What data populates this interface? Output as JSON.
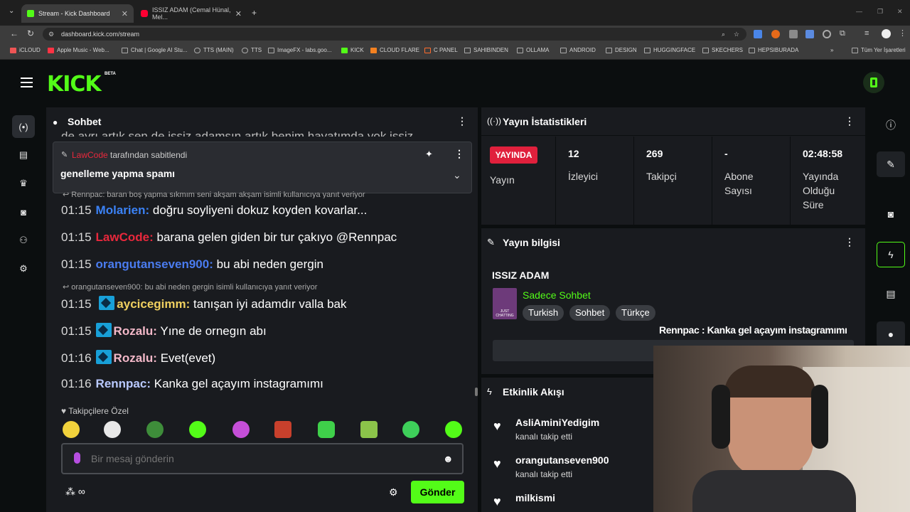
{
  "browser": {
    "tabs": [
      {
        "title": "Stream - Kick Dashboard",
        "active": true
      },
      {
        "title": "ISSIZ ADAM (Cemal Hünal, Mel...",
        "active": false
      }
    ],
    "url": "dashboard.kick.com/stream",
    "bookmarks": [
      "iCLOUD",
      "Apple Music - Web...",
      "Chat | Google AI Stu...",
      "TTS (MAIN)",
      "TTS",
      "ImageFX - labs.goo...",
      "KICK",
      "CLOUD FLARE",
      "C PANEL",
      "SAHIBINDEN",
      "OLLAMA",
      "ANDROID",
      "DESIGN",
      "HUGGINGFACE",
      "SKECHERS",
      "HEPSIBURADA"
    ],
    "all_bookmarks": "Tüm Yer İşaretleri"
  },
  "brand": {
    "logo": "KICK",
    "beta": "BETA",
    "accent": "#53fc18"
  },
  "chat": {
    "title": "Sohbet",
    "cut_line": "de ayrı artık sen de issiz adamsın artık benim hayatımda yok issiz",
    "pinned": {
      "user": "LawCode",
      "suffix": "tarafından sabitlendi",
      "message": "genelleme yapma spamı"
    },
    "reply_partial": "Rennpac: baran boş yapma sıkmım seni akşam akşam isimli kullanıcıya yanıt veriyor",
    "messages": [
      {
        "time": "01:15",
        "user": "Molarien",
        "text": "doğru soyliyeni dokuz koyden kovarlar...",
        "color": "#3b82f6"
      },
      {
        "time": "01:15",
        "user": "LawCode",
        "text": "barana gelen giden bir tur çakıyo @Rennpac",
        "color": "#e8283c"
      },
      {
        "time": "01:15",
        "user": "orangutanseven900",
        "text": "bu abi neden gergin",
        "color": "#4a7cf0"
      },
      {
        "time": "01:15",
        "user": "aycicegimm",
        "text": "tanışan iyi adamdır valla bak",
        "color": "#f0d060"
      },
      {
        "time": "01:15",
        "user": "Rozalu",
        "text": "Yıne de ornegın abı",
        "color": "#f3b8c8"
      },
      {
        "time": "01:16",
        "user": "Rozalu",
        "text": "Evet(evet)",
        "color": "#f3b8c8"
      },
      {
        "time": "01:16",
        "user": "Rennpac",
        "text": "Kanka gel açayım instagramımı",
        "color": "#b9c9ff"
      }
    ],
    "reply_context": "orangutanseven900: bu abi neden gergin isimli kullanıcıya yanıt veriyor",
    "followers_only": "Takipçilere Özel",
    "input_placeholder": "Bir mesaj gönderin",
    "send": "Gönder"
  },
  "stats": {
    "title": "Yayın İstatistikleri",
    "live_badge": "YAYINDA",
    "live_label": "Yayın",
    "items": [
      {
        "value": "12",
        "label": "İzleyici"
      },
      {
        "value": "269",
        "label": "Takipçi"
      },
      {
        "value": "-",
        "label": "Abone Sayısı"
      },
      {
        "value": "02:48:58",
        "label": "Yayında Olduğu Süre"
      }
    ]
  },
  "info": {
    "title": "Yayın bilgisi",
    "stream_title": "ISSIZ ADAM",
    "category": "Sadece Sohbet",
    "category_thumb": "JUST CHATTING",
    "tags": [
      "Turkish",
      "Sohbet",
      "Türkçe"
    ],
    "overlay": "Rennpac : Kanka gel açayım instagramımı"
  },
  "activity": {
    "title": "Etkinlik Akışı",
    "items": [
      {
        "name": "AsliAminiYedigim",
        "sub": "kanalı takip etti"
      },
      {
        "name": "orangutanseven900",
        "sub": "kanalı takip etti"
      },
      {
        "name": "milkismi",
        "sub": ""
      }
    ]
  }
}
